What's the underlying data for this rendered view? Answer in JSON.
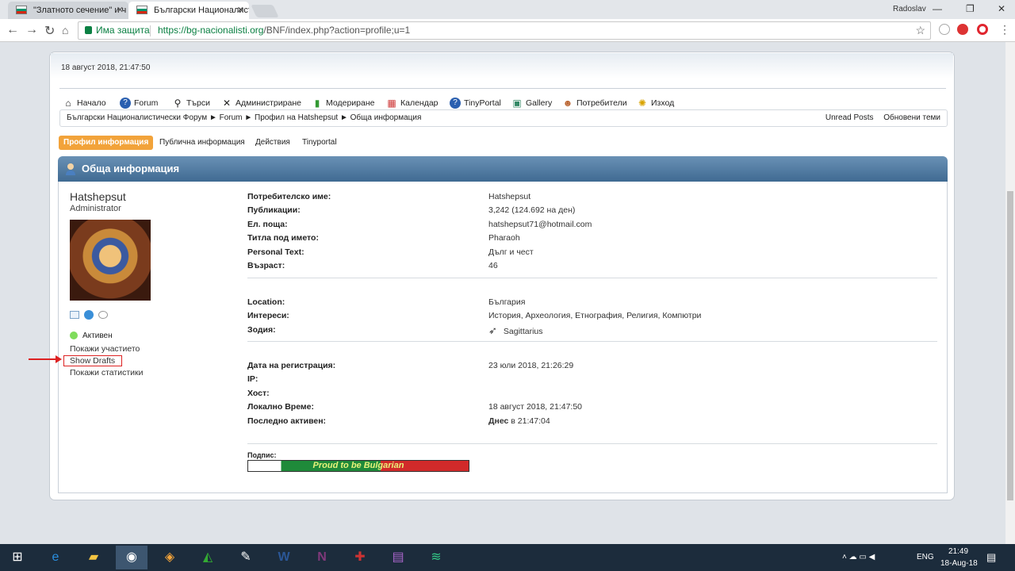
{
  "browser": {
    "tabs": [
      {
        "label": "\"Златното сечение\" и ч"
      },
      {
        "label": "Български Националист"
      }
    ],
    "user": "Radoslav",
    "security_label": "Има защита",
    "url_host": "https://bg-nacionalisti.org",
    "url_path": "/BNF/index.php?action=profile;u=1"
  },
  "forum": {
    "date": "18 август 2018, 21:47:50",
    "menu": [
      {
        "label": "Начало",
        "icon": "home-icon"
      },
      {
        "label": "Forum",
        "icon": "help-icon"
      },
      {
        "label": "Търси",
        "icon": "search-icon"
      },
      {
        "label": "Администриране",
        "icon": "tools-icon"
      },
      {
        "label": "Модериране",
        "icon": "traffic-light-icon"
      },
      {
        "label": "Календар",
        "icon": "calendar-icon"
      },
      {
        "label": "TinyPortal",
        "icon": "help-icon"
      },
      {
        "label": "Gallery",
        "icon": "image-icon"
      },
      {
        "label": "Потребители",
        "icon": "users-icon"
      },
      {
        "label": "Изход",
        "icon": "bulb-icon"
      }
    ],
    "breadcrumb": [
      "Български Националистически Форум",
      "Forum",
      "Профил на Hatshepsut",
      "Обща информация"
    ],
    "crumb_links": [
      "Unread Posts",
      "Обновени теми"
    ],
    "profile_tabs": [
      "Профил информация",
      "Публична информация",
      "Действия",
      "Tinyportal"
    ],
    "category_title": "Обща информация"
  },
  "profile": {
    "username": "Hatshepsut",
    "role": "Administrator",
    "status": "Активен",
    "links": [
      "Покажи участието",
      "Show Drafts",
      "Покажи статистики"
    ],
    "group1": [
      {
        "k": "Потребителско име:",
        "v": "Hatshepsut"
      },
      {
        "k": "Публикации:",
        "v": "3,242 (124.692 на ден)"
      },
      {
        "k": "Ел. поща:",
        "v": "hatshepsut71@hotmail.com"
      },
      {
        "k": "Титла под името:",
        "v": "Pharaoh"
      },
      {
        "k": "Personal Text:",
        "v": "Дълг и чест"
      },
      {
        "k": "Възраст:",
        "v": "46"
      }
    ],
    "group2": [
      {
        "k": "Location:",
        "v": "България"
      },
      {
        "k": "Интереси:",
        "v": "История, Археология, Етнография, Религия, Компютри"
      },
      {
        "k": "Зодия:",
        "v": "Sagittarius"
      }
    ],
    "group3": [
      {
        "k": "Дата на регистрация:",
        "v": "23 юли 2018, 21:26:29"
      },
      {
        "k": "IP:",
        "v": ""
      },
      {
        "k": "Хост:",
        "v": ""
      },
      {
        "k": "Локално Време:",
        "v": "18 август 2018, 21:47:50"
      },
      {
        "k": "Последно активен:",
        "v_bold": "Днес",
        "v": " в 21:47:04"
      }
    ],
    "signature_label": "Подпис:",
    "signature_banner": "Proud to be Bulgarian"
  },
  "taskbar": {
    "lang": "ENG",
    "time": "21:49",
    "date": "18-Aug-18"
  }
}
